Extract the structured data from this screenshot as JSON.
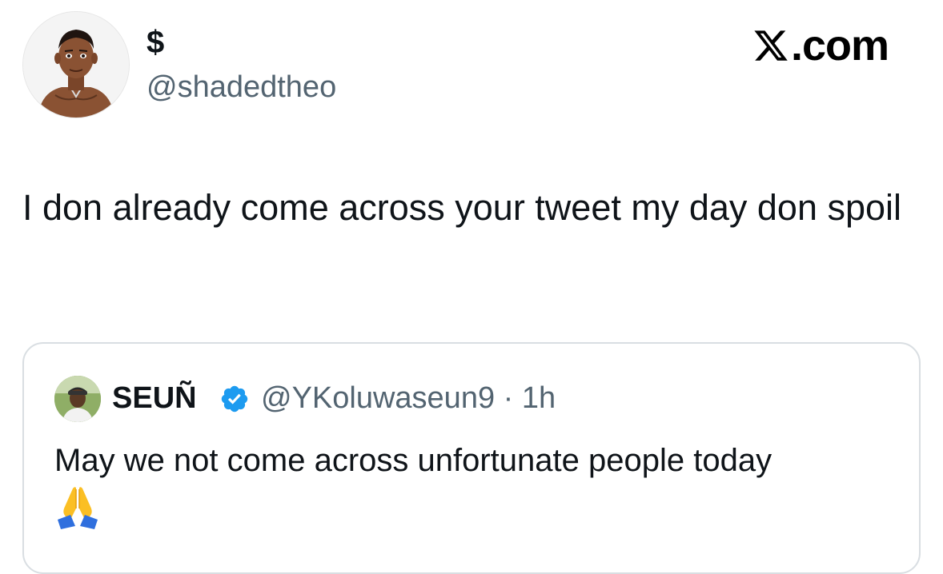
{
  "author": {
    "display_name": "$",
    "handle": "@shadedtheo",
    "avatar_icon": "cartoon-avatar-icon"
  },
  "platform": {
    "logo_label": ".com",
    "logo_icon": "x-logo-icon"
  },
  "tweet": {
    "text": "I don already come across your tweet my day don spoil"
  },
  "quoted_tweet": {
    "display_name": "SEUÑ",
    "handle": "@YKoluwaseun9",
    "separator": " · ",
    "time": "1h",
    "verified": true,
    "verified_color": "#1d9bf0",
    "text": "May we not come across unfortunate people today",
    "emoji_icon": "praying-hands-icon"
  },
  "colors": {
    "primary_text": "#0f1419",
    "secondary_text": "#536471",
    "border": "#d9dee2"
  }
}
